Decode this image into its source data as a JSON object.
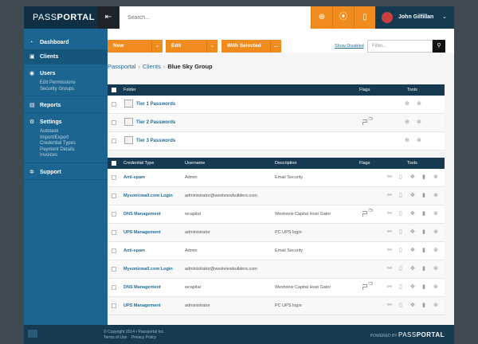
{
  "brand": {
    "name_light": "PASS",
    "name_bold": "PORTAL"
  },
  "search": {
    "placeholder": "Search..."
  },
  "user": {
    "name": "John Gilfillan"
  },
  "sidebar": {
    "items": [
      {
        "label": "Dashboard",
        "active": false,
        "icon": "gauge-icon",
        "subitems": []
      },
      {
        "label": "Clients",
        "active": true,
        "icon": "clients-icon",
        "subitems": []
      },
      {
        "label": "Users",
        "active": false,
        "icon": "user-icon",
        "subitems": [
          "Edit Permissions",
          "Security Groups"
        ]
      },
      {
        "label": "Reports",
        "active": false,
        "icon": "reports-icon",
        "subitems": []
      },
      {
        "label": "Settings",
        "active": false,
        "icon": "gear-icon",
        "subitems": [
          "Autotask",
          "Import/Export",
          "Credential Types",
          "Payment Details",
          "Invoices"
        ]
      },
      {
        "label": "Support",
        "active": false,
        "icon": "support-icon",
        "subitems": []
      }
    ]
  },
  "actions": {
    "new_label": "New",
    "edit_label": "Edit",
    "with_selected_label": "With Selected",
    "show_disabled_label": "Show Disabled",
    "filter_placeholder": "Filter..."
  },
  "breadcrumb": {
    "root": "Passportal",
    "section": "Clients",
    "current": "Blue Sky Group"
  },
  "folders_table": {
    "headers": {
      "folder": "Folder",
      "flags": "Flags",
      "tools": "Tools"
    },
    "rows": [
      {
        "name": "Tier 1 Passwords",
        "flag_count": null
      },
      {
        "name": "Tier 2 Passwords",
        "flag_count": "3"
      },
      {
        "name": "Tier 3 Passwords",
        "flag_count": null
      }
    ]
  },
  "credentials_table": {
    "headers": {
      "type": "Credential Type",
      "username": "Username",
      "description": "Description",
      "flags": "Flags",
      "tools": "Tools"
    },
    "rows": [
      {
        "type": "Anti-spam",
        "username": "Admin",
        "description": "Email Security",
        "flag_count": null
      },
      {
        "type": "Mysonicwall.com Login",
        "username": "administrator@westviewbuilders.com",
        "description": "",
        "flag_count": null
      },
      {
        "type": "DNS Management",
        "username": "wcapital",
        "description": "Westview Capital Host Gator",
        "flag_count": "3"
      },
      {
        "type": "UPS Management",
        "username": "administrator",
        "description": "PC UPS login",
        "flag_count": null
      },
      {
        "type": "Anti-spam",
        "username": "Admin",
        "description": "Email Security",
        "flag_count": null
      },
      {
        "type": "Mysonicwall.com Login",
        "username": "administrator@westviewbuilders.com",
        "description": "",
        "flag_count": null
      },
      {
        "type": "DNS Management",
        "username": "wcapital",
        "description": "Westview Capital Host Gator",
        "flag_count": "3"
      },
      {
        "type": "UPS Management",
        "username": "administrator",
        "description": "PC UPS login",
        "flag_count": null
      }
    ]
  },
  "footer": {
    "copyright": "© Copyright 2014 • Passportal Inc.",
    "terms": "Terms of Use",
    "privacy": "Privacy Policy",
    "powered_by": "POWERED BY",
    "brand_light": "PASS",
    "brand_bold": "PORTAL"
  },
  "colors": {
    "navy": "#153a52",
    "sidebar": "#1c6590",
    "accent": "#ef8c1d",
    "link": "#1f6e9a"
  }
}
